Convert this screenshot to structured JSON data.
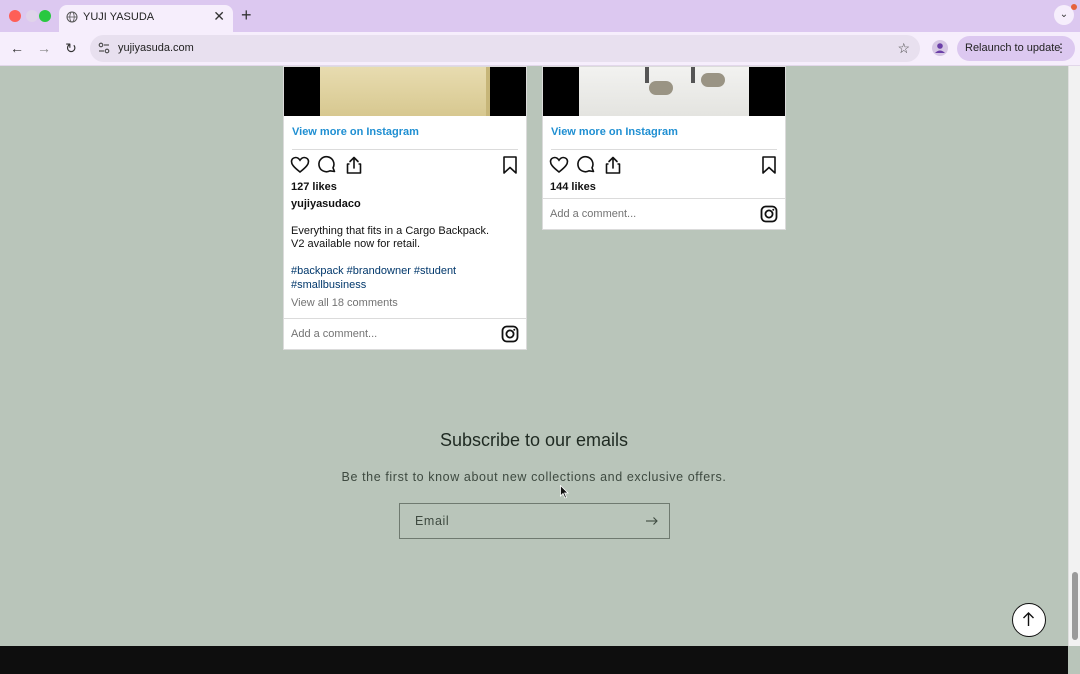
{
  "browser": {
    "tab_title": "YUJI YASUDA",
    "tab_close": "✕",
    "new_tab": "+",
    "url": "yujiyasuda.com",
    "relaunch_label": "Relaunch to update",
    "relaunch_menu": "⋮",
    "tab_menu": "⌄",
    "nav": {
      "back": "←",
      "forward": "→",
      "reload": "↻",
      "bookmark": "☆"
    }
  },
  "posts": [
    {
      "view_more": "View more on Instagram",
      "likes": "127 likes",
      "username": "yujiyasudaco",
      "caption_line1": "Everything that fits in a Cargo Backpack.",
      "caption_line2": "V2 available now for retail.",
      "hashtags": "#backpack #brandowner #student #smallbusiness",
      "view_all": "View all 18 comments",
      "comment_placeholder": "Add a comment..."
    },
    {
      "view_more": "View more on Instagram",
      "likes": "144 likes",
      "comment_placeholder": "Add a comment..."
    }
  ],
  "newsletter": {
    "title": "Subscribe to our emails",
    "subtitle": "Be the first to know about new collections and exclusive offers.",
    "email_label": "Email"
  },
  "colors": {
    "page_background": "#b9c5ba",
    "link_blue": "#1f8fd2",
    "tab_strip": "#dcc8f0",
    "footer": "#0e0e0e"
  },
  "icons": [
    "globe-icon",
    "site-info-icon",
    "star-icon",
    "profile-icon",
    "heart-icon",
    "comment-icon",
    "share-icon",
    "bookmark-icon",
    "instagram-icon",
    "arrow-right-icon",
    "arrow-up-icon"
  ]
}
